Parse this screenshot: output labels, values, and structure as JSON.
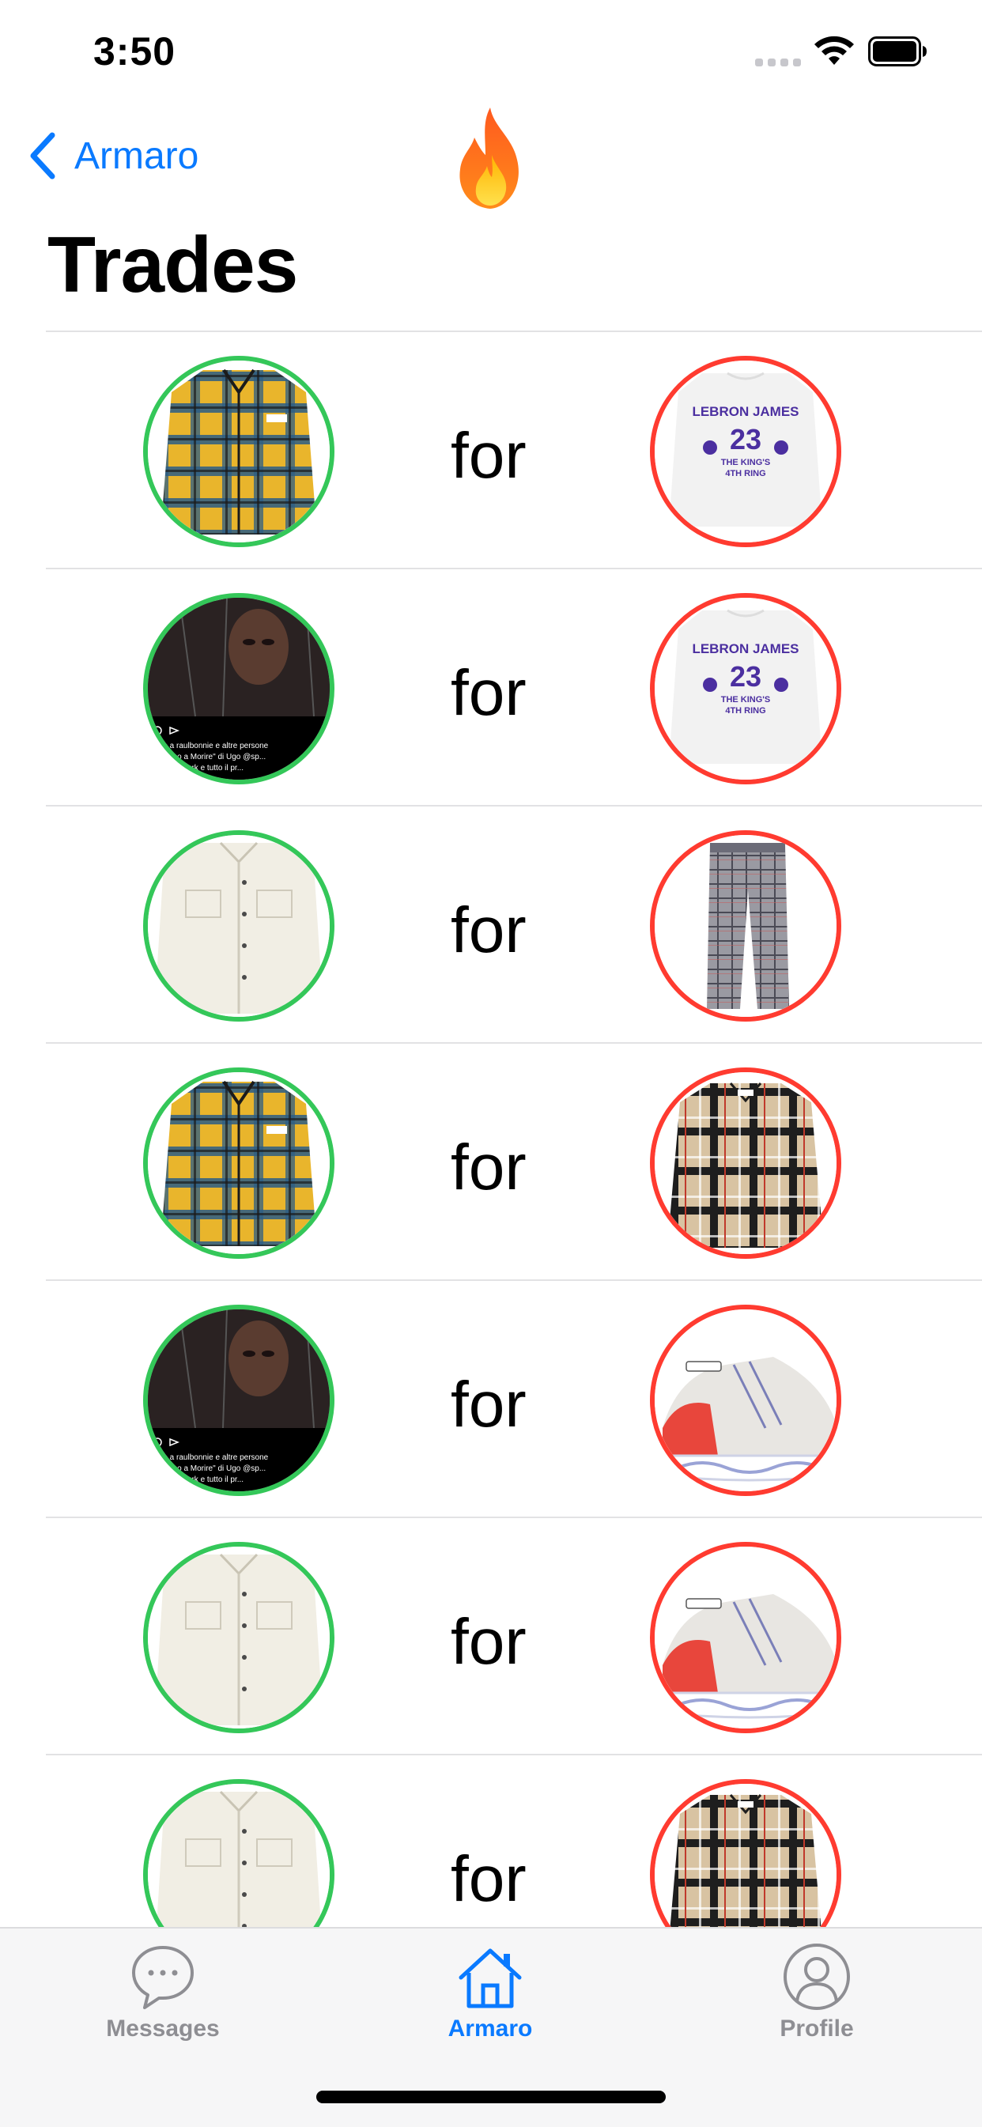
{
  "status_bar": {
    "time": "3:50"
  },
  "nav": {
    "back_label": "Armaro"
  },
  "page": {
    "title": "Trades"
  },
  "trades": [
    {
      "give": "plaid-flannel-shirt-yellow",
      "connector": "for",
      "get": "lebron-james-longsleeve-tee"
    },
    {
      "give": "music-post-screenshot",
      "connector": "for",
      "get": "lebron-james-longsleeve-tee"
    },
    {
      "give": "cream-overshirt",
      "connector": "for",
      "get": "plaid-trousers"
    },
    {
      "give": "plaid-flannel-shirt-yellow",
      "connector": "for",
      "get": "beige-check-shirt"
    },
    {
      "give": "music-post-screenshot",
      "connector": "for",
      "get": "white-sneaker"
    },
    {
      "give": "cream-overshirt",
      "connector": "for",
      "get": "white-sneaker"
    },
    {
      "give": "cream-overshirt",
      "connector": "for",
      "get": "beige-check-shirt"
    }
  ],
  "images": {
    "lebron-james-longsleeve-tee": {
      "line1": "LEBRON JAMES",
      "number": "23",
      "line2": "THE KING'S",
      "line3": "4TH RING"
    },
    "music-post-screenshot": {
      "caption1": "...ce a raulbonnie e altre persone",
      "caption2": "...Ultimo a Morire\" di Ugo @sp...",
      "caption3": "...ato artwork e tutto il pr..."
    }
  },
  "tabbar": {
    "items": [
      {
        "label": "Messages",
        "icon": "chat-bubble-icon",
        "active": false
      },
      {
        "label": "Armaro",
        "icon": "house-icon",
        "active": true
      },
      {
        "label": "Profile",
        "icon": "person-icon",
        "active": false
      }
    ]
  },
  "colors": {
    "accent": "#0a7aff",
    "give_ring": "#34c759",
    "get_ring": "#ff3b30",
    "inactive": "#8e8e93"
  }
}
